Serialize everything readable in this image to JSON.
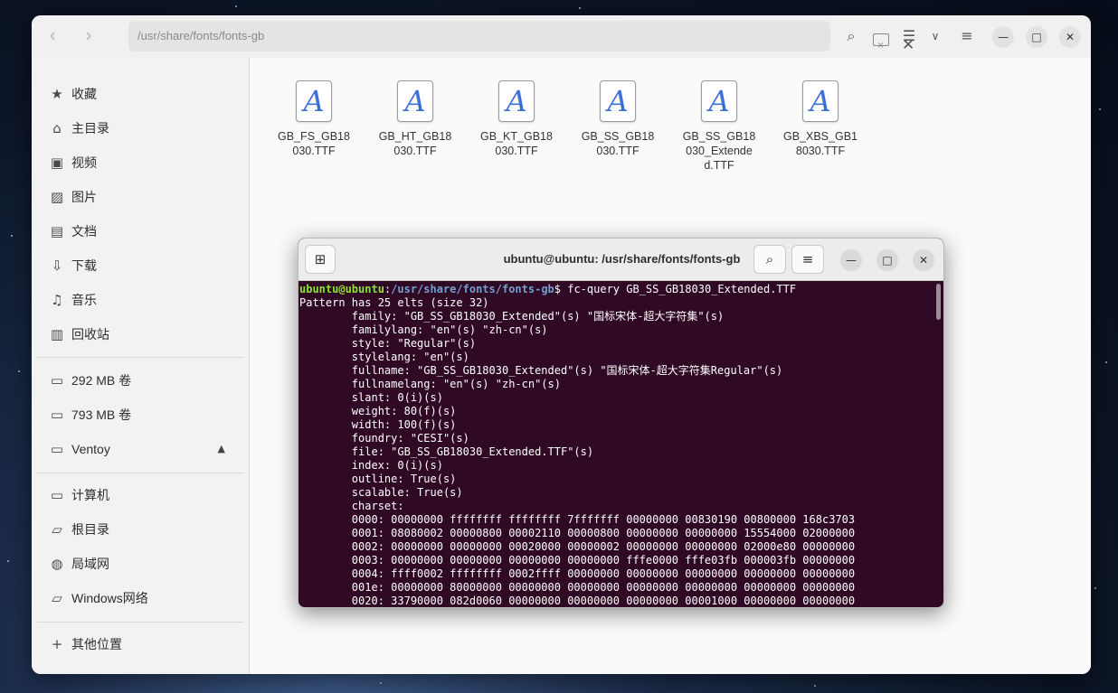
{
  "file_manager": {
    "path": "/usr/share/fonts/fonts-gb",
    "sidebar": {
      "places": [
        {
          "icon": "star-icon",
          "glyph": "★",
          "label": "收藏"
        },
        {
          "icon": "home-icon",
          "glyph": "⌂",
          "label": "主目录"
        },
        {
          "icon": "video-icon",
          "glyph": "▣",
          "label": "视频"
        },
        {
          "icon": "picture-icon",
          "glyph": "▨",
          "label": "图片"
        },
        {
          "icon": "document-icon",
          "glyph": "▤",
          "label": "文档"
        },
        {
          "icon": "download-icon",
          "glyph": "⇩",
          "label": "下载"
        },
        {
          "icon": "music-icon",
          "glyph": "♫",
          "label": "音乐"
        },
        {
          "icon": "trash-icon",
          "glyph": "▥",
          "label": "回收站"
        }
      ],
      "volumes": [
        {
          "icon": "drive-icon",
          "glyph": "▭",
          "label": "292 MB 卷"
        },
        {
          "icon": "drive-icon",
          "glyph": "▭",
          "label": "793 MB 卷"
        },
        {
          "icon": "drive-icon",
          "glyph": "▭",
          "label": "Ventoy",
          "eject": "▲"
        }
      ],
      "network": [
        {
          "icon": "computer-icon",
          "glyph": "▭",
          "label": "计算机"
        },
        {
          "icon": "folder-icon",
          "glyph": "▱",
          "label": "根目录"
        },
        {
          "icon": "network-icon",
          "glyph": "◍",
          "label": "局域网"
        },
        {
          "icon": "folder-icon",
          "glyph": "▱",
          "label": "Windows网络"
        }
      ],
      "other": {
        "icon": "plus-icon",
        "glyph": "+",
        "label": "其他位置"
      }
    },
    "files": [
      {
        "name": "GB_FS_GB18030.TTF",
        "display": "GB_FS_GB18\n030.TTF"
      },
      {
        "name": "GB_HT_GB18030.TTF",
        "display": "GB_HT_GB18\n030.TTF"
      },
      {
        "name": "GB_KT_GB18030.TTF",
        "display": "GB_KT_GB18\n030.TTF"
      },
      {
        "name": "GB_SS_GB18030.TTF",
        "display": "GB_SS_GB18\n030.TTF"
      },
      {
        "name": "GB_SS_GB18030_Extended.TTF",
        "display": "GB_SS_GB18\n030_Extende\nd.TTF"
      },
      {
        "name": "GB_XBS_GB18030.TTF",
        "display": "GB_XBS_GB1\n8030.TTF"
      }
    ],
    "file_icon_glyph": "A"
  },
  "terminal": {
    "title": "ubuntu@ubuntu: /usr/share/fonts/fonts-gb",
    "prompt_user": "ubuntu@ubuntu",
    "prompt_sep": ":",
    "prompt_path": "/usr/share/fonts/fonts-gb",
    "prompt_end": "$ ",
    "command": "fc-query GB_SS_GB18030_Extended.TTF",
    "output": [
      "Pattern has 25 elts (size 32)",
      "        family: \"GB_SS_GB18030_Extended\"(s) \"国标宋体-超大字符集\"(s)",
      "        familylang: \"en\"(s) \"zh-cn\"(s)",
      "        style: \"Regular\"(s)",
      "        stylelang: \"en\"(s)",
      "        fullname: \"GB_SS_GB18030_Extended\"(s) \"国标宋体-超大字符集Regular\"(s)",
      "        fullnamelang: \"en\"(s) \"zh-cn\"(s)",
      "        slant: 0(i)(s)",
      "        weight: 80(f)(s)",
      "        width: 100(f)(s)",
      "        foundry: \"CESI\"(s)",
      "        file: \"GB_SS_GB18030_Extended.TTF\"(s)",
      "        index: 0(i)(s)",
      "        outline: True(s)",
      "        scalable: True(s)",
      "        charset:",
      "        0000: 00000000 ffffffff ffffffff 7fffffff 00000000 00830190 00800000 168c3703",
      "        0001: 08080002 00000800 00002110 00000800 00000000 00000000 15554000 02000000",
      "        0002: 00000000 00000000 00020000 00000002 00000000 00000000 02000e80 00000000",
      "        0003: 00000000 00000000 00000000 00000000 fffe0000 fffe03fb 000003fb 00000000",
      "        0004: ffff0002 ffffffff 0002ffff 00000000 00000000 00000000 00000000 00000000",
      "        001e: 00000000 80000000 00000000 00000000 00000000 00000000 00000000 00000000",
      "        0020: 33790000 082d0060 00000000 00000000 00000000 00001000 00000000 00000000"
    ]
  }
}
